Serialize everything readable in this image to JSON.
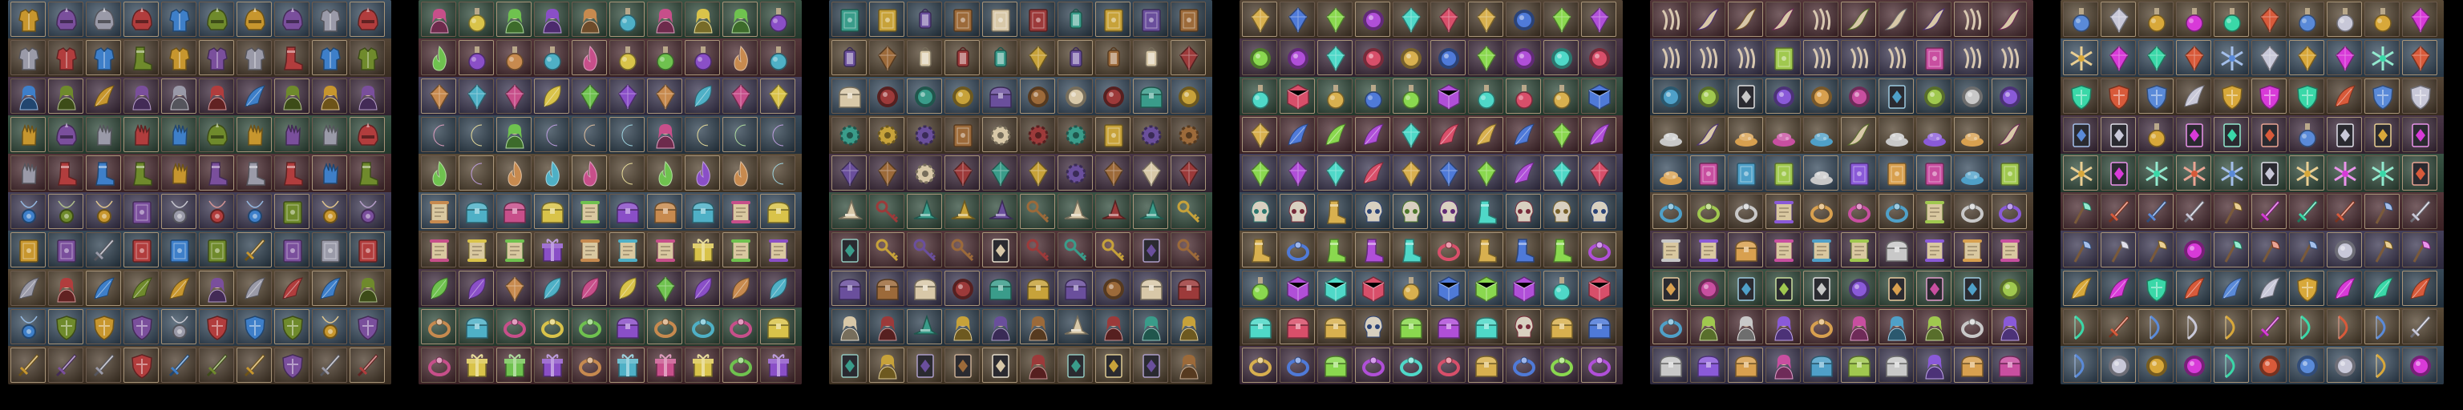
{
  "colors": {
    "page_background": "#000000",
    "sheet_background": "#3a2433",
    "cell_frame": "#6b5a4c",
    "cell_frame_highlight": "#a89478",
    "band_palette": [
      "#35495c",
      "#4a3a2a",
      "#3e2a3c",
      "#2f4a3a",
      "#4a2a2f",
      "#3a3550",
      "#2c3f4f",
      "#50402c"
    ]
  },
  "sheets": [
    {
      "theme": [
        "#c7962e",
        "#7a4f9c",
        "#9a9aa8",
        "#b13d3d",
        "#3e7fc9",
        "#6f8a2c"
      ],
      "icons": [
        "helmet-icon",
        "armor-icon",
        "figure-icon",
        "gauntlet-icon",
        "boot-icon",
        "amulet-icon",
        "book-icon",
        "wing-icon",
        "shield-icon",
        "sword-icon"
      ]
    },
    {
      "theme": [
        "#4fb0c6",
        "#c74f8a",
        "#d9c34a",
        "#6fc24f",
        "#8a4fc7",
        "#c78a4f"
      ],
      "icons": [
        "gift-box-icon",
        "portrait-icon",
        "potion-icon",
        "gem-icon",
        "moon-icon",
        "fire-icon",
        "chest-icon",
        "scroll-icon",
        "leaf-icon",
        "bracelet-icon"
      ]
    },
    {
      "theme": [
        "#d8c8a8",
        "#9c3a3a",
        "#3a9c8a",
        "#c7a23a",
        "#6a4f9c",
        "#9c6a3a"
      ],
      "icons": [
        "portrait-icon",
        "card-icon",
        "book-icon",
        "lantern-icon",
        "orb-icon",
        "gear-icon",
        "crystal-icon",
        "hat-icon",
        "key-icon",
        "chest-icon"
      ]
    },
    {
      "theme": [
        "#b04fd8",
        "#4fd8c8",
        "#d84f6a",
        "#d8b04f",
        "#4f7ad8",
        "#8ad84f"
      ],
      "icons": [
        "cube-icon",
        "chest-icon",
        "ring-icon",
        "gem-icon",
        "orb-icon",
        "potion-icon",
        "feather-icon",
        "crystal-icon",
        "skull-icon",
        "boot-icon"
      ]
    },
    {
      "theme": [
        "#d8a04f",
        "#c84fa0",
        "#4fa0c8",
        "#a0c84f",
        "#c8c8c8",
        "#8a5ad8"
      ],
      "icons": [
        "scroll-icon",
        "card-icon",
        "portrait-icon",
        "chest-icon",
        "horn-icon",
        "claw-icon",
        "orb-icon",
        "pile-icon",
        "book-icon",
        "bracelet-icon"
      ]
    },
    {
      "theme": [
        "#c8c8d8",
        "#d8a83a",
        "#d83ad8",
        "#3ad8a8",
        "#d85a3a",
        "#5a8ad8"
      ],
      "icons": [
        "sword-icon",
        "axe-icon",
        "feather-icon",
        "bow-icon",
        "orb-icon",
        "potion-icon",
        "gem-icon",
        "shield-icon",
        "card-icon",
        "snowflake-icon"
      ]
    }
  ]
}
